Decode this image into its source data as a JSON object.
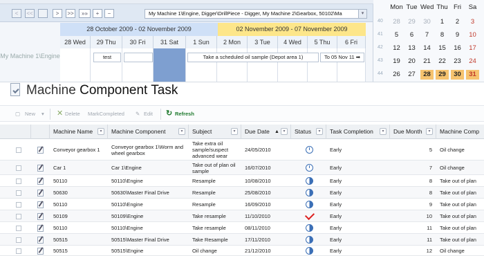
{
  "scheduler": {
    "nav_buttons": [
      "<",
      "<<",
      ">",
      ">>",
      "»»",
      "+",
      "−"
    ],
    "path": "My Machine 1\\Engine, Digger\\DrillPiece - Digger, My Machine 2\\Gearbox, 50102\\Ma",
    "weeks": [
      "28 October 2009 - 02 November 2009",
      "02 November 2009 - 07 November 2009"
    ],
    "days": [
      "28 Wed",
      "29 Thu",
      "30 Fri",
      "31 Sat",
      "1 Sun",
      "2 Mon",
      "3 Tue",
      "4 Wed",
      "5 Thu",
      "6 Fri"
    ],
    "resource": "My Machine 1\\Engine",
    "events": [
      {
        "label": "test"
      },
      {
        "label": ""
      },
      {
        "label": "Take a scheduled oil sample (Depot area 1)"
      },
      {
        "label": "To 05 Nov 11 ➡"
      }
    ]
  },
  "calendar": {
    "headers": [
      "Mon",
      "Tue",
      "Wed",
      "Thu",
      "Fri",
      "Sa"
    ],
    "rows": [
      {
        "wk": "40",
        "days": [
          "28",
          "29",
          "30",
          "1",
          "2",
          "3"
        ]
      },
      {
        "wk": "41",
        "days": [
          "5",
          "6",
          "7",
          "8",
          "9",
          "10"
        ]
      },
      {
        "wk": "42",
        "days": [
          "12",
          "13",
          "14",
          "15",
          "16",
          "17"
        ]
      },
      {
        "wk": "43",
        "days": [
          "19",
          "20",
          "21",
          "22",
          "23",
          "24"
        ]
      },
      {
        "wk": "44",
        "days": [
          "26",
          "27",
          "28",
          "29",
          "30",
          "31"
        ]
      }
    ]
  },
  "page": {
    "title_light": "Machine ",
    "title_bold": "Component Task"
  },
  "toolbar": {
    "new": "New",
    "delete": "Delete",
    "mark_completed": "MarkCompleted",
    "edit": "Edit",
    "refresh": "Refresh"
  },
  "grid": {
    "columns": [
      "Machine Name",
      "Machine Component",
      "Subject",
      "Due Date",
      "Status",
      "Task Completion",
      "Due Month",
      "Machine Comp"
    ],
    "rows": [
      {
        "machine": "Conveyor gearbox 1",
        "component": "Conveyor gearbox 1\\Worm and wheel gearbox",
        "subject": "Take extra oil sample/suspect advanced wear",
        "due": "24/05/2010",
        "status": "clock",
        "completion": "Early",
        "month": "5",
        "mcomp": "Oil change"
      },
      {
        "machine": "Car 1",
        "component": "Car 1\\Engine",
        "subject": "Take out of plan oil sample",
        "due": "16/07/2010",
        "status": "clock",
        "completion": "Early",
        "month": "7",
        "mcomp": "Oil change"
      },
      {
        "machine": "50110",
        "component": "50110\\Engine",
        "subject": "Resample",
        "due": "10/08/2010",
        "status": "half",
        "completion": "Early",
        "month": "8",
        "mcomp": "Take out of plan"
      },
      {
        "machine": "50630",
        "component": "50630\\Master Final Drive",
        "subject": "Resample",
        "due": "25/08/2010",
        "status": "half",
        "completion": "Early",
        "month": "8",
        "mcomp": "Take out of plan"
      },
      {
        "machine": "50110",
        "component": "50110\\Engine",
        "subject": "Resample",
        "due": "16/09/2010",
        "status": "half",
        "completion": "Early",
        "month": "9",
        "mcomp": "Take out of plan"
      },
      {
        "machine": "50109",
        "component": "50109\\Engine",
        "subject": "Take resample",
        "due": "11/10/2010",
        "status": "done",
        "completion": "Early",
        "month": "10",
        "mcomp": "Take out of plan"
      },
      {
        "machine": "50110",
        "component": "50110\\Engine",
        "subject": "Take resample",
        "due": "08/11/2010",
        "status": "half",
        "completion": "Early",
        "month": "11",
        "mcomp": "Take out of plan"
      },
      {
        "machine": "50515",
        "component": "50515\\Master Final Drive",
        "subject": "Take Resample",
        "due": "17/11/2010",
        "status": "half",
        "completion": "Early",
        "month": "11",
        "mcomp": "Take out of plan"
      },
      {
        "machine": "50515",
        "component": "50515\\Engine",
        "subject": "Oil change",
        "due": "21/12/2010",
        "status": "half",
        "completion": "Early",
        "month": "12",
        "mcomp": "Oil change"
      }
    ]
  }
}
